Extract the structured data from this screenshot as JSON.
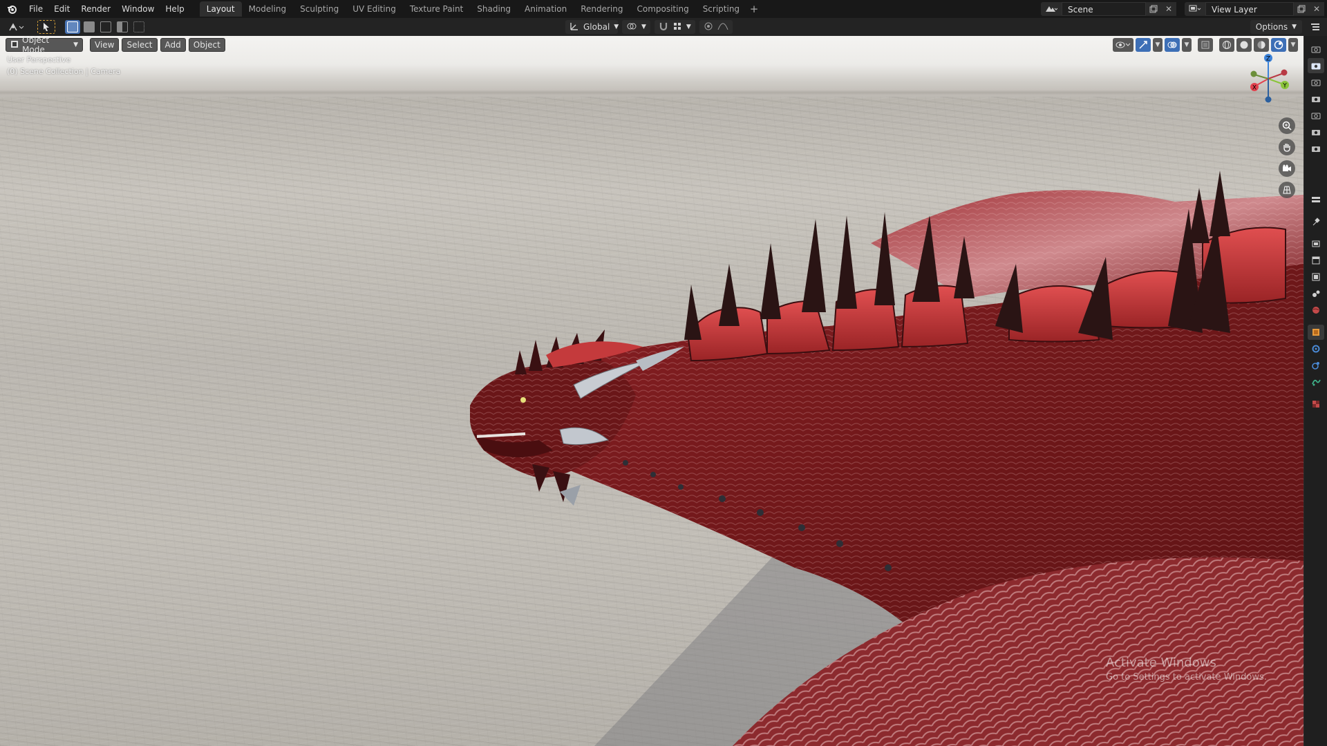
{
  "menu": {
    "file": "File",
    "edit": "Edit",
    "render": "Render",
    "window": "Window",
    "help": "Help"
  },
  "workspace_tabs": [
    {
      "label": "Layout",
      "active": true
    },
    {
      "label": "Modeling"
    },
    {
      "label": "Sculpting"
    },
    {
      "label": "UV Editing"
    },
    {
      "label": "Texture Paint"
    },
    {
      "label": "Shading"
    },
    {
      "label": "Animation"
    },
    {
      "label": "Rendering"
    },
    {
      "label": "Compositing"
    },
    {
      "label": "Scripting"
    }
  ],
  "top_right": {
    "scene_name": "Scene",
    "view_layer_name": "View Layer"
  },
  "header": {
    "transform_orientation": "Global",
    "options_label": "Options"
  },
  "viewport": {
    "mode": "Object Mode",
    "view_menu": "View",
    "select_menu": "Select",
    "add_menu": "Add",
    "object_menu": "Object",
    "perspective_label": "User Perspective",
    "collection_label": "(0) Scene Collection | Camera"
  },
  "gizmo": {
    "z": "Z",
    "y": "Y",
    "x": "X",
    "x_color": "#e2424e",
    "y_color": "#8ac43a",
    "z_color": "#3b82d9"
  },
  "watermark": {
    "line1": "Activate Windows",
    "line2": "Go to Settings to activate Windows."
  },
  "colors": {
    "accent": "#4772b3",
    "dragon_body": "#7a1a1c",
    "dragon_plate": "#c63a3c",
    "spike": "#2a1414"
  },
  "icons": {
    "properties_strip": [
      "tool-icon",
      "render-icon",
      "output-icon",
      "view-layer-icon",
      "scene-icon",
      "world-icon",
      "object-icon",
      "modifier-icon",
      "physics-icon",
      "constraint-icon",
      "data-icon",
      "texture-icon"
    ]
  }
}
